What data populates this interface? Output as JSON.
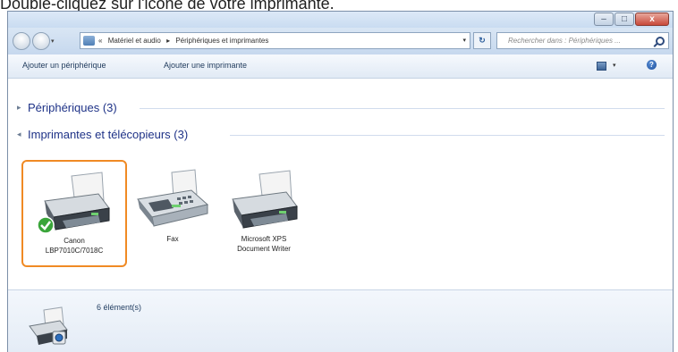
{
  "caption": "Double-cliquez sur l'icône de votre imprimante.",
  "window": {
    "controls": {
      "minimize": "–",
      "maximize": "□",
      "close": "x"
    }
  },
  "address": {
    "overflow": "«",
    "crumbs": [
      "Matériel et audio",
      "▸",
      "Périphériques et imprimantes"
    ],
    "dropdown": "▾",
    "refresh": "↻",
    "search_placeholder": "Rechercher dans : Périphériques ..."
  },
  "toolbar": {
    "add_device": "Ajouter un périphérique",
    "add_printer": "Ajouter une imprimante",
    "views_dropdown": "▾",
    "help": "?"
  },
  "groups": {
    "devices": {
      "arrow": "▸",
      "label": "Périphériques (3)"
    },
    "printers": {
      "arrow": "◂",
      "label": "Imprimantes et télécopieurs (3)"
    }
  },
  "printers": [
    {
      "name_line1": "Canon",
      "name_line2": "LBP7010C/7018C",
      "default": true,
      "selected": true
    },
    {
      "name_line1": "Fax",
      "name_line2": "",
      "default": false,
      "selected": false
    },
    {
      "name_line1": "Microsoft XPS",
      "name_line2": "Document Writer",
      "default": false,
      "selected": false
    }
  ],
  "details": {
    "count": "6 élément(s)"
  },
  "colors": {
    "selection_border": "#f08a24",
    "group_header": "#1e3287",
    "default_check": "#3aa53a"
  }
}
